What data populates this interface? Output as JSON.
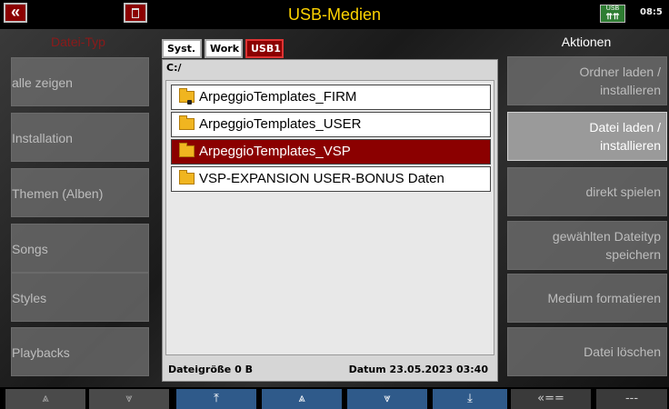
{
  "topbar": {
    "back_glyph": "«",
    "title": "USB-Medien",
    "usb_icon_label": "USB",
    "usb_icon_arrows": "⇈⇈",
    "clock": "08:5"
  },
  "left": {
    "header": "Datei-Typ",
    "items": [
      {
        "label": "alle zeigen"
      },
      {
        "label": "Installation"
      },
      {
        "label": "Themen (Alben)"
      },
      {
        "label": "Songs"
      },
      {
        "label": "Styles"
      },
      {
        "label": "Playbacks"
      }
    ]
  },
  "tabs": [
    {
      "label": "Syst."
    },
    {
      "label": "Work"
    },
    {
      "label": "USB1",
      "active": true
    }
  ],
  "browser": {
    "path": "C:/",
    "rows": [
      {
        "name": "ArpeggioTemplates_FIRM",
        "locked": true
      },
      {
        "name": "ArpeggioTemplates_USER",
        "locked": false
      },
      {
        "name": "ArpeggioTemplates_VSP",
        "locked": false,
        "selected": true
      },
      {
        "name": "VSP-EXPANSION USER-BONUS Daten",
        "locked": false
      }
    ],
    "size_text": "Dateigröße 0 B",
    "date_text": "Datum 23.05.2023   03:40"
  },
  "right": {
    "header": "Aktionen",
    "actions": [
      {
        "line1": "Ordner laden /",
        "line2": "installieren"
      },
      {
        "line1": "Datei laden /",
        "line2": "installieren",
        "active": true
      },
      {
        "line1": "direkt spielen",
        "line2": ""
      },
      {
        "line1": "gewählten Dateityp",
        "line2": "speichern"
      },
      {
        "line1": "Medium formatieren",
        "line2": ""
      },
      {
        "line1": "Datei löschen",
        "line2": ""
      }
    ]
  },
  "bottom": {
    "buttons": [
      "≈",
      "≈",
      "⌅",
      "≈",
      "≈",
      "⌄",
      "«==",
      "---"
    ],
    "glyphs": [
      "⩓",
      "⩔",
      "⤒",
      "⩓",
      "⩔",
      "⤓",
      "«==",
      "---"
    ]
  },
  "colors": {
    "title": "#ffd400",
    "accent_red": "#8b0000",
    "nav_blue": "#2f5a8a"
  }
}
